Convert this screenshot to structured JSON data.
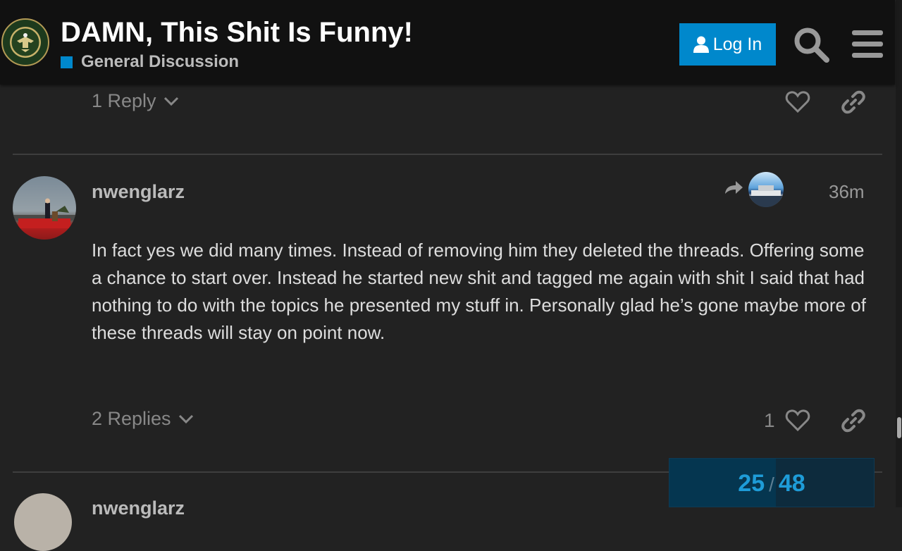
{
  "header": {
    "logo_text": "INFOWARS ARMY",
    "title": "DAMN, This Shit Is Funny!",
    "category": "General Discussion",
    "category_color": "#0088cc",
    "login_label": "Log In",
    "login_icon": "user-icon",
    "search_icon": "search-icon",
    "menu_icon": "hamburger-menu-icon"
  },
  "previous_post": {
    "replies_label": "1 Reply",
    "like_icon": "heart-icon",
    "link_icon": "link-icon"
  },
  "post": {
    "username": "nwenglarz",
    "time": "36m",
    "reply_icon": "reply-arrow-icon",
    "body": "In fact yes we did many times. Instead of removing him they deleted the threads. Offering some a chance to start over. Instead he started new shit and tagged me again with shit I said that had nothing to do with the topics he presented my stuff in. Personally glad he’s gone maybe more of these threads will stay on point now.",
    "replies_label": "2 Replies",
    "like_count": "1"
  },
  "next_post": {
    "username": "nwenglarz"
  },
  "progress": {
    "current": "25",
    "separator": "/",
    "total": "48",
    "fraction": 0.52
  },
  "colors": {
    "accent": "#0088cc",
    "background": "#222222",
    "header_bg": "#111111"
  }
}
